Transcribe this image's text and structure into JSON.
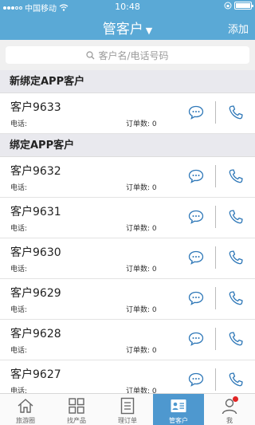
{
  "status": {
    "carrier": "中国移动",
    "time": "10:48"
  },
  "nav": {
    "title": "管客户",
    "add_label": "添加"
  },
  "search": {
    "placeholder": "客户名/电话号码"
  },
  "labels": {
    "phone": "电话:",
    "orders": "订单数:"
  },
  "sections": [
    {
      "title": "新绑定APP客户",
      "customers": [
        {
          "name": "客户9633",
          "phone": "",
          "orders": "0"
        }
      ]
    },
    {
      "title": "绑定APP客户",
      "customers": [
        {
          "name": "客户9632",
          "phone": "",
          "orders": "0"
        },
        {
          "name": "客户9631",
          "phone": "",
          "orders": "0"
        },
        {
          "name": "客户9630",
          "phone": "",
          "orders": "0"
        },
        {
          "name": "客户9629",
          "phone": "",
          "orders": "0"
        },
        {
          "name": "客户9628",
          "phone": "",
          "orders": "0"
        },
        {
          "name": "客户9627",
          "phone": "",
          "orders": "0"
        }
      ]
    }
  ],
  "tabs": [
    {
      "label": "旅游圈",
      "icon": "home-icon",
      "active": false
    },
    {
      "label": "找产品",
      "icon": "grid-icon",
      "active": false
    },
    {
      "label": "理订单",
      "icon": "document-icon",
      "active": false
    },
    {
      "label": "管客户",
      "icon": "contacts-icon",
      "active": true
    },
    {
      "label": "我",
      "icon": "user-icon",
      "active": false,
      "badge": true
    }
  ],
  "colors": {
    "primary": "#5aa9d6",
    "tab_active": "#4e98cf",
    "icon_blue": "#2f78b8",
    "badge": "#e12525"
  }
}
